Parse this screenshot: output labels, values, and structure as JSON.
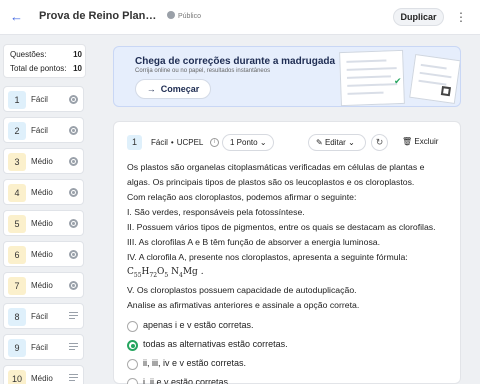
{
  "header": {
    "back_icon": "arrow-left-icon",
    "title": "Prova de Reino Plantae: Pl...",
    "visibility": "Público",
    "duplicate_label": "Duplicar",
    "more_icon": "more-vertical-icon"
  },
  "sidebar": {
    "stats": {
      "questions_label": "Questões:",
      "questions_value": "10",
      "points_label": "Total de pontos:",
      "points_value": "10"
    },
    "items": [
      {
        "num": "1",
        "difficulty": "Fácil",
        "type_icon": "radio-icon"
      },
      {
        "num": "2",
        "difficulty": "Fácil",
        "type_icon": "radio-icon"
      },
      {
        "num": "3",
        "difficulty": "Médio",
        "type_icon": "radio-icon"
      },
      {
        "num": "4",
        "difficulty": "Médio",
        "type_icon": "radio-icon"
      },
      {
        "num": "5",
        "difficulty": "Médio",
        "type_icon": "radio-icon"
      },
      {
        "num": "6",
        "difficulty": "Médio",
        "type_icon": "radio-icon"
      },
      {
        "num": "7",
        "difficulty": "Médio",
        "type_icon": "radio-icon"
      },
      {
        "num": "8",
        "difficulty": "Fácil",
        "type_icon": "text-lines-icon"
      },
      {
        "num": "9",
        "difficulty": "Fácil",
        "type_icon": "text-lines-icon"
      },
      {
        "num": "10",
        "difficulty": "Médio",
        "type_icon": "text-lines-icon"
      }
    ]
  },
  "banner": {
    "title": "Chega de correções durante a madrugada",
    "subtitle": "Corrija online ou no papel, resultados instantâneos",
    "button_label": "Começar"
  },
  "question": {
    "num": "1",
    "difficulty": "Fácil",
    "source": "UCPEL",
    "points_label": "1 Ponto",
    "edit_label": "Editar",
    "delete_label": "Excluir",
    "lines": [
      "Os plastos são organelas citoplasmáticas verificadas em células de plantas e",
      "algas. Os principais tipos de plastos são os leucoplastos e os cloroplastos.",
      "Com relação aos cloroplastos, podemos afirmar o seguinte:",
      "I. São verdes, responsáveis pela fotossíntese.",
      "II. Possuem vários tipos de pigmentos, entre os quais se destacam as clorofilas.",
      "III. As clorofilas A e B têm função de absorver a energia luminosa.",
      "IV. A clorofila A, presente nos cloroplastos, apresenta a seguinte fórmula:"
    ],
    "formula": {
      "c": "C",
      "c_sub": "55",
      "h": "H",
      "h_sub": "72",
      "o": "O",
      "o_sub": "5",
      "n": "N",
      "n_sub": "4",
      "mg": "Mg",
      "end": "."
    },
    "lines_after": [
      "V. Os cloroplastos possuem capacidade de autoduplicação.",
      "Analise as afirmativas anteriores e assinale a opção correta."
    ],
    "options": [
      {
        "text": "apenas i e v estão corretas.",
        "selected": false
      },
      {
        "text": "todas as alternativas estão corretas.",
        "selected": true
      },
      {
        "text": "ii, iii, iv e v estão corretas.",
        "selected": false
      },
      {
        "text": "i, ii e v estão corretas.",
        "selected": false
      }
    ]
  },
  "colors": {
    "accent": "#3e64e2",
    "correct": "#25a55f",
    "easy_badge": "#dff0fb",
    "medium_badge": "#fbf0cc"
  }
}
